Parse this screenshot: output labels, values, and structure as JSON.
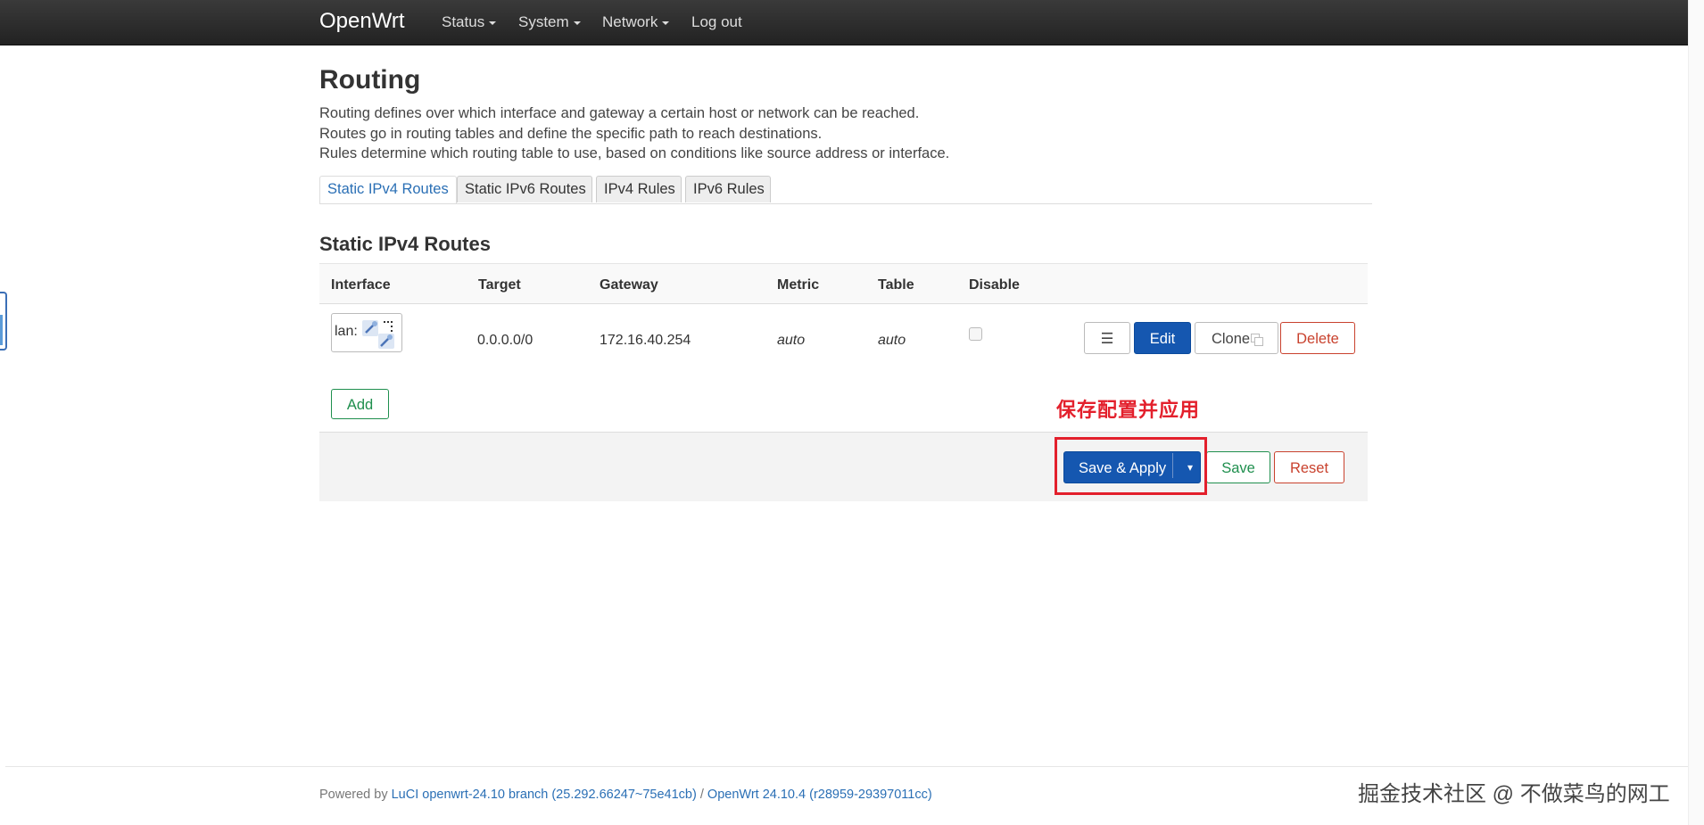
{
  "navbar": {
    "brand": "OpenWrt",
    "items": [
      {
        "label": "Status"
      },
      {
        "label": "System"
      },
      {
        "label": "Network"
      },
      {
        "label": "Log out"
      }
    ]
  },
  "page": {
    "title": "Routing",
    "description": [
      "Routing defines over which interface and gateway a certain host or network can be reached.",
      "Routes go in routing tables and define the specific path to reach destinations.",
      "Rules determine which routing table to use, based on conditions like source address or interface."
    ]
  },
  "tabs": [
    {
      "label": "Static IPv4 Routes",
      "active": true
    },
    {
      "label": "Static IPv6 Routes",
      "active": false
    },
    {
      "label": "IPv4 Rules",
      "active": false
    },
    {
      "label": "IPv6 Rules",
      "active": false
    }
  ],
  "section": {
    "title": "Static IPv4 Routes",
    "columns": [
      "Interface",
      "Target",
      "Gateway",
      "Metric",
      "Table",
      "Disable"
    ],
    "rows": [
      {
        "interface": "lan:",
        "target": "0.0.0.0/0",
        "gateway": "172.16.40.254",
        "metric": "auto",
        "table": "auto",
        "disabled": false
      }
    ],
    "row_actions": {
      "menu_glyph": "☰",
      "edit": "Edit",
      "clone": "Clone",
      "delete": "Delete"
    },
    "add_label": "Add"
  },
  "actions": {
    "save_apply": "Save & Apply",
    "dropdown_glyph": "▾",
    "save": "Save",
    "reset": "Reset"
  },
  "annotation": {
    "text": "保存配置并应用",
    "color": "#e3202c"
  },
  "footer": {
    "powered_by": "Powered by",
    "luci_link": "LuCI openwrt-24.10 branch (25.292.66247~75e41cb)",
    "separator": "/",
    "openwrt_link": "OpenWrt 24.10.4 (r28959-29397011cc)"
  },
  "watermark": "掘金技术社区 @ 不做菜鸟的网工",
  "colors": {
    "primary": "#1557b0",
    "negative": "#c9422e",
    "positive": "#1f8f4e",
    "link": "#2a6fb5"
  }
}
